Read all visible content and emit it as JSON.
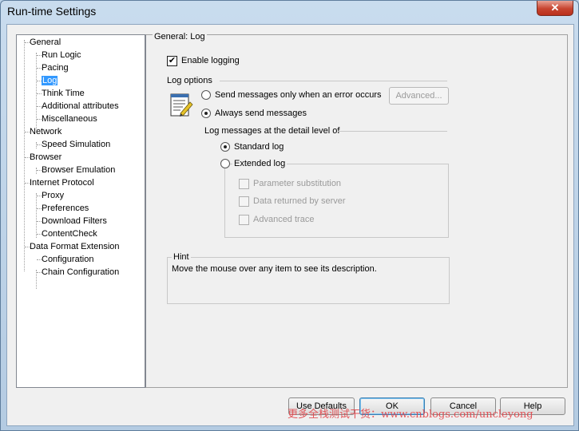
{
  "window": {
    "title": "Run-time Settings",
    "close_label": "✕"
  },
  "tree": {
    "items": [
      {
        "label": "General",
        "level": 0
      },
      {
        "label": "Run Logic",
        "level": 1
      },
      {
        "label": "Pacing",
        "level": 1
      },
      {
        "label": "Log",
        "level": 1,
        "selected": true
      },
      {
        "label": "Think Time",
        "level": 1
      },
      {
        "label": "Additional attributes",
        "level": 1
      },
      {
        "label": "Miscellaneous",
        "level": 1
      },
      {
        "label": "Network",
        "level": 0
      },
      {
        "label": "Speed Simulation",
        "level": 1
      },
      {
        "label": "Browser",
        "level": 0
      },
      {
        "label": "Browser Emulation",
        "level": 1
      },
      {
        "label": "Internet Protocol",
        "level": 0
      },
      {
        "label": "Proxy",
        "level": 1
      },
      {
        "label": "Preferences",
        "level": 1
      },
      {
        "label": "Download Filters",
        "level": 1
      },
      {
        "label": "ContentCheck",
        "level": 1
      },
      {
        "label": "Data Format Extension",
        "level": 0
      },
      {
        "label": "Configuration",
        "level": 1
      },
      {
        "label": "Chain Configuration",
        "level": 1
      }
    ]
  },
  "panel": {
    "title": "General: Log",
    "enable_logging": {
      "label": "Enable logging",
      "checked": true
    },
    "log_options": {
      "label": "Log options",
      "send_on_error": {
        "label": "Send messages only when an error occurs",
        "selected": false
      },
      "advanced_button": "Advanced...",
      "always_send": {
        "label": "Always send messages",
        "selected": true
      }
    },
    "detail_level": {
      "label": "Log messages at the detail level of",
      "standard": {
        "label": "Standard log",
        "selected": true
      },
      "extended": {
        "label": "Extended log",
        "selected": false
      },
      "parameter_substitution": {
        "label": "Parameter substitution",
        "checked": false
      },
      "data_returned": {
        "label": "Data returned by server",
        "checked": false
      },
      "advanced_trace": {
        "label": "Advanced trace",
        "checked": false
      }
    },
    "hint": {
      "label": "Hint",
      "text": "Move the mouse over any item to see its description."
    }
  },
  "footer": {
    "use_defaults": "Use Defaults",
    "ok": "OK",
    "cancel": "Cancel",
    "help": "Help",
    "watermark": "更多全栈测试干货：www.cnblogs.com/uncleyong"
  },
  "colors": {
    "selection": "#3399ff",
    "watermark": "#e2454a"
  }
}
